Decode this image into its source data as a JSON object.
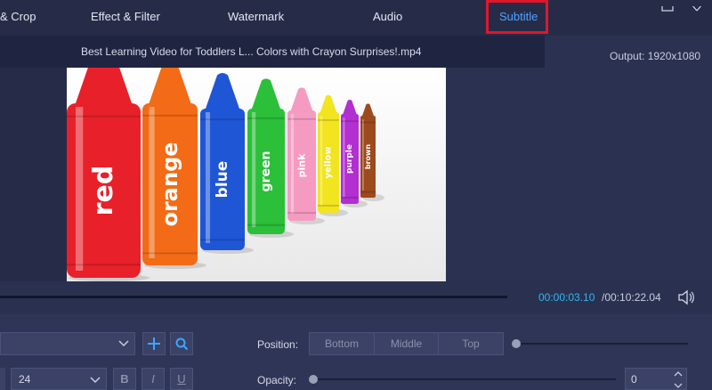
{
  "tabs": [
    {
      "label": "& Crop",
      "active": false
    },
    {
      "label": "Effect & Filter",
      "active": false
    },
    {
      "label": "Watermark",
      "active": false
    },
    {
      "label": "Audio",
      "active": false
    },
    {
      "label": "Subtitle",
      "active": true
    }
  ],
  "window_controls": [
    "maximize-icon",
    "close-icon"
  ],
  "file": {
    "name": "Best Learning Video for Toddlers L... Colors with Crayon Surprises!.mp4"
  },
  "output": {
    "label": "Output: 1920x1080"
  },
  "video": {
    "crayons": [
      {
        "label": "red",
        "color": "#e8202a"
      },
      {
        "label": "orange",
        "color": "#f36b16"
      },
      {
        "label": "blue",
        "color": "#1f56d6"
      },
      {
        "label": "green",
        "color": "#2bbf3a"
      },
      {
        "label": "pink",
        "color": "#f59bc2"
      },
      {
        "label": "yellow",
        "color": "#f2e41f"
      },
      {
        "label": "purple",
        "color": "#b22fd0"
      },
      {
        "label": "brown",
        "color": "#9c4a1e"
      }
    ]
  },
  "playback": {
    "current_time": "00:00:03.10",
    "total_time": "/00:10:22.04"
  },
  "subtitle_controls": {
    "position_label": "Position:",
    "position_options": [
      "Bottom",
      "Middle",
      "Top"
    ],
    "font_size": "24",
    "style_buttons": [
      "B",
      "I",
      "U"
    ],
    "opacity_label": "Opacity:",
    "opacity_value": "0"
  },
  "colors": {
    "accent": "#4ea3ff",
    "highlight": "#e0162b",
    "time": "#2fb6f0"
  }
}
